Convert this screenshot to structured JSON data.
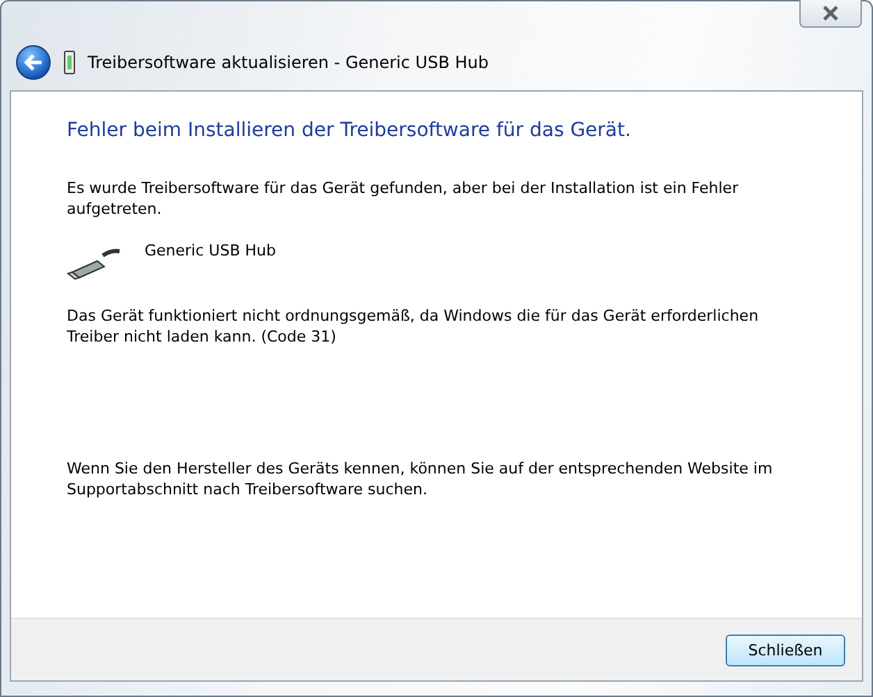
{
  "window": {
    "title": "Treibersoftware aktualisieren - Generic USB Hub"
  },
  "heading": "Fehler beim Installieren der Treibersoftware für das Gerät.",
  "intro": "Es wurde Treibersoftware für das Gerät gefunden, aber bei der Installation ist ein Fehler aufgetreten.",
  "device": {
    "name": "Generic USB Hub"
  },
  "status": "Das Gerät funktioniert nicht ordnungsgemäß, da Windows die für das Gerät erforderlichen Treiber nicht laden kann. (Code 31)",
  "hint": "Wenn Sie den Hersteller des Geräts kennen, können Sie auf der entsprechenden Website im Supportabschnitt nach Treibersoftware suchen.",
  "buttons": [
    "Schließen"
  ]
}
